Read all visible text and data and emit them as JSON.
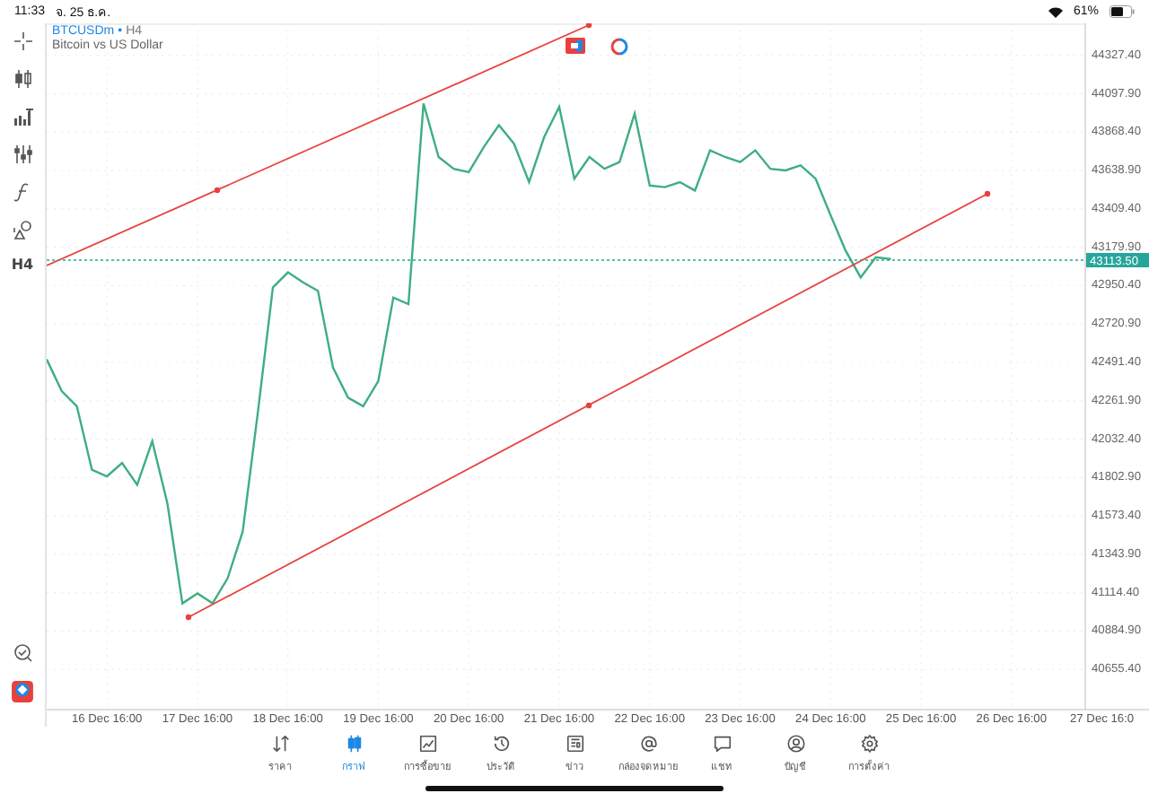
{
  "status_bar": {
    "time": "11:33",
    "date": "จ. 25 ธ.ค.",
    "battery": "61%"
  },
  "toolbar": {
    "timeframe": "H4"
  },
  "chart": {
    "symbol": "BTCUSDm",
    "separator": "•",
    "timeframe": "H4",
    "description": "Bitcoin vs US Dollar",
    "chart_data": {
      "type": "line",
      "categories": [
        null,
        null,
        null,
        null,
        "16 Dec 16:00",
        null,
        null,
        null,
        null,
        null,
        "17 Dec 16:00",
        null,
        null,
        null,
        null,
        null,
        "18 Dec 16:00",
        null,
        null,
        null,
        null,
        null,
        "19 Dec 16:00",
        null,
        null,
        null,
        null,
        null,
        "20 Dec 16:00",
        null,
        null,
        null,
        null,
        null,
        "21 Dec 16:00",
        null,
        null,
        null,
        null,
        null,
        "22 Dec 16:00",
        null,
        null,
        null,
        null,
        null,
        "23 Dec 16:00",
        null,
        null,
        null,
        null,
        null,
        "24 Dec 16:00",
        null,
        null,
        null,
        null,
        null,
        "25 Dec 16:00",
        null,
        null,
        null,
        null,
        null,
        "26 Dec 16:00",
        null,
        null,
        null,
        null,
        null,
        "27 Dec 16:0"
      ],
      "series": [
        {
          "color": "#3fae82",
          "values": [
            42510,
            42320,
            42230,
            41850,
            41810,
            41890,
            41760,
            42020,
            41650,
            41050,
            41110,
            41050,
            41200,
            41480,
            42190,
            42940,
            43030,
            42970,
            42920,
            42460,
            42280,
            42230,
            42380,
            42880,
            42840,
            44040,
            43720,
            43650,
            43630,
            43780,
            43910,
            43800,
            43570,
            43840,
            44020,
            43590,
            43720,
            43650,
            43690,
            43980,
            43550,
            43540,
            43570,
            43520,
            43760,
            43720,
            43690,
            43760,
            43650,
            43640,
            43670,
            43590,
            43370,
            43160,
            43000,
            43120,
            43110,
            null,
            null,
            null,
            null,
            null,
            null,
            null,
            null,
            null,
            null,
            null,
            null,
            null,
            null
          ]
        }
      ],
      "ylim": [
        40420,
        44520
      ],
      "yticks": [
        {
          "value": 44327.4,
          "label": "44327.40"
        },
        {
          "value": 44097.9,
          "label": "44097.90"
        },
        {
          "value": 43868.4,
          "label": "43868.40"
        },
        {
          "value": 43638.9,
          "label": "43638.90"
        },
        {
          "value": 43409.4,
          "label": "43409.40"
        },
        {
          "value": 43179.9,
          "label": "43179.90"
        },
        {
          "value": 42950.4,
          "label": "42950.40"
        },
        {
          "value": 42720.9,
          "label": "42720.90"
        },
        {
          "value": 42491.4,
          "label": "42491.40"
        },
        {
          "value": 42261.9,
          "label": "42261.90"
        },
        {
          "value": 42032.4,
          "label": "42032.40"
        },
        {
          "value": 41802.9,
          "label": "41802.90"
        },
        {
          "value": 41573.4,
          "label": "41573.40"
        },
        {
          "value": 41343.9,
          "label": "41343.90"
        },
        {
          "value": 41114.4,
          "label": "41114.40"
        },
        {
          "value": 40884.9,
          "label": "40884.90"
        },
        {
          "value": 40655.4,
          "label": "40655.40"
        }
      ],
      "grid": true
    },
    "current_price": "43113.50"
  },
  "nav": [
    {
      "label": "ราคา",
      "kind": "quotes",
      "selected": false
    },
    {
      "label": "กราฟ",
      "kind": "chart",
      "selected": true
    },
    {
      "label": "การซื้อขาย",
      "kind": "trade",
      "selected": false
    },
    {
      "label": "ประวัติ",
      "kind": "history",
      "selected": false
    },
    {
      "label": "ข่าว",
      "kind": "news",
      "selected": false
    },
    {
      "label": "กล่องจดหมาย",
      "kind": "mail",
      "selected": false
    },
    {
      "label": "แชท",
      "kind": "chat",
      "selected": false
    },
    {
      "label": "บัญชี",
      "kind": "account",
      "selected": false
    },
    {
      "label": "การตั้งค่า",
      "kind": "settings",
      "selected": false
    }
  ]
}
